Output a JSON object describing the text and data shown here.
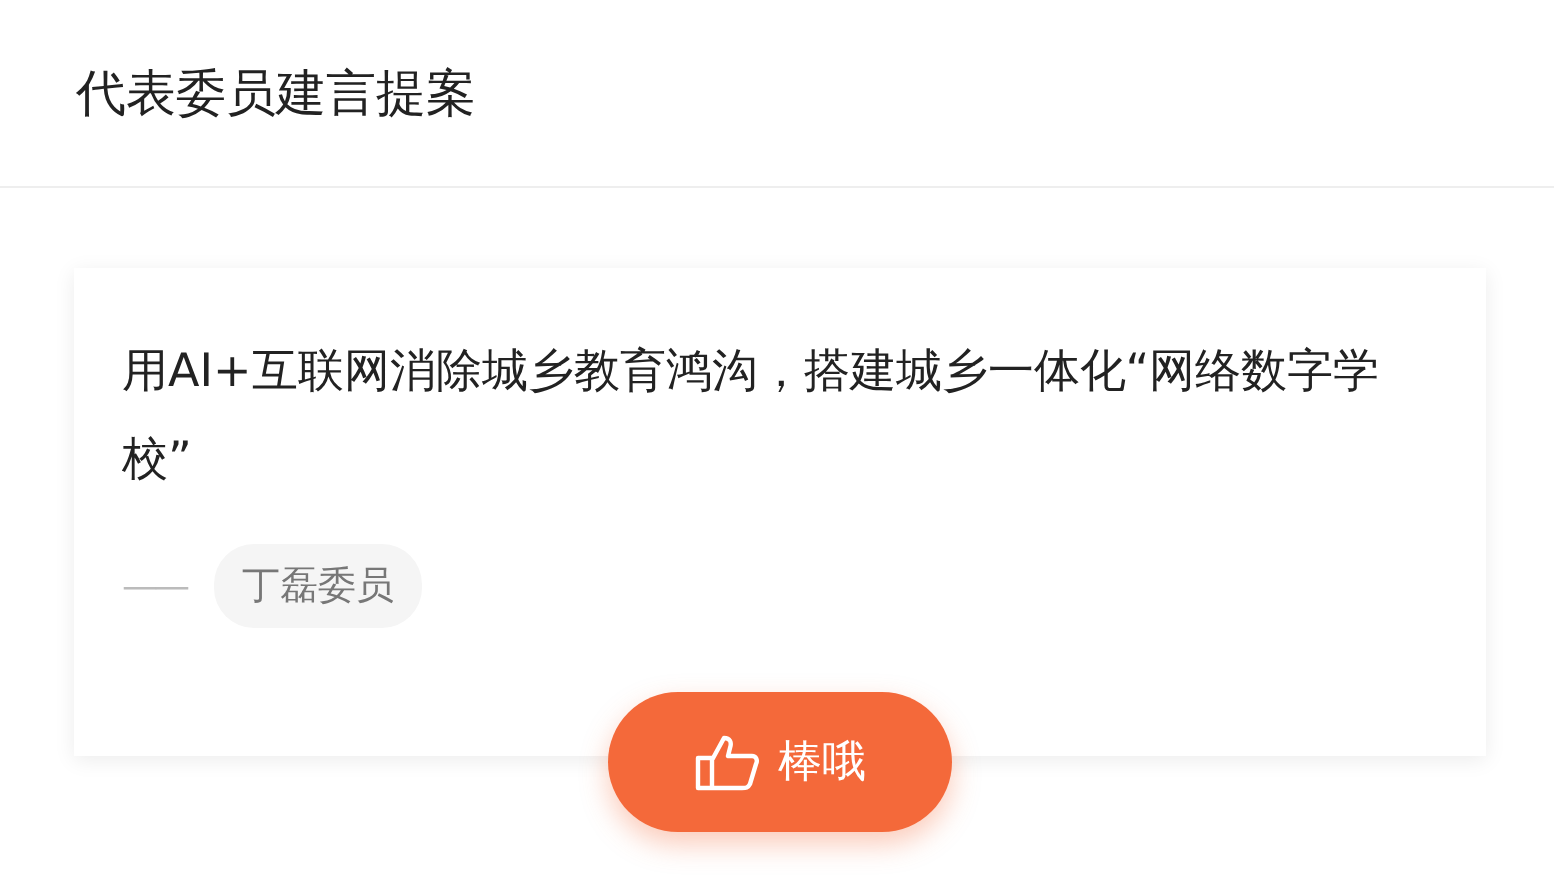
{
  "header": {
    "title": "代表委员建言提案"
  },
  "proposal": {
    "text": "用AI+互联网消除城乡教育鸿沟，搭建城乡一体化“网络数字学校”",
    "dash": "——",
    "author": "丁磊委员"
  },
  "like_button": {
    "label": "棒哦"
  }
}
